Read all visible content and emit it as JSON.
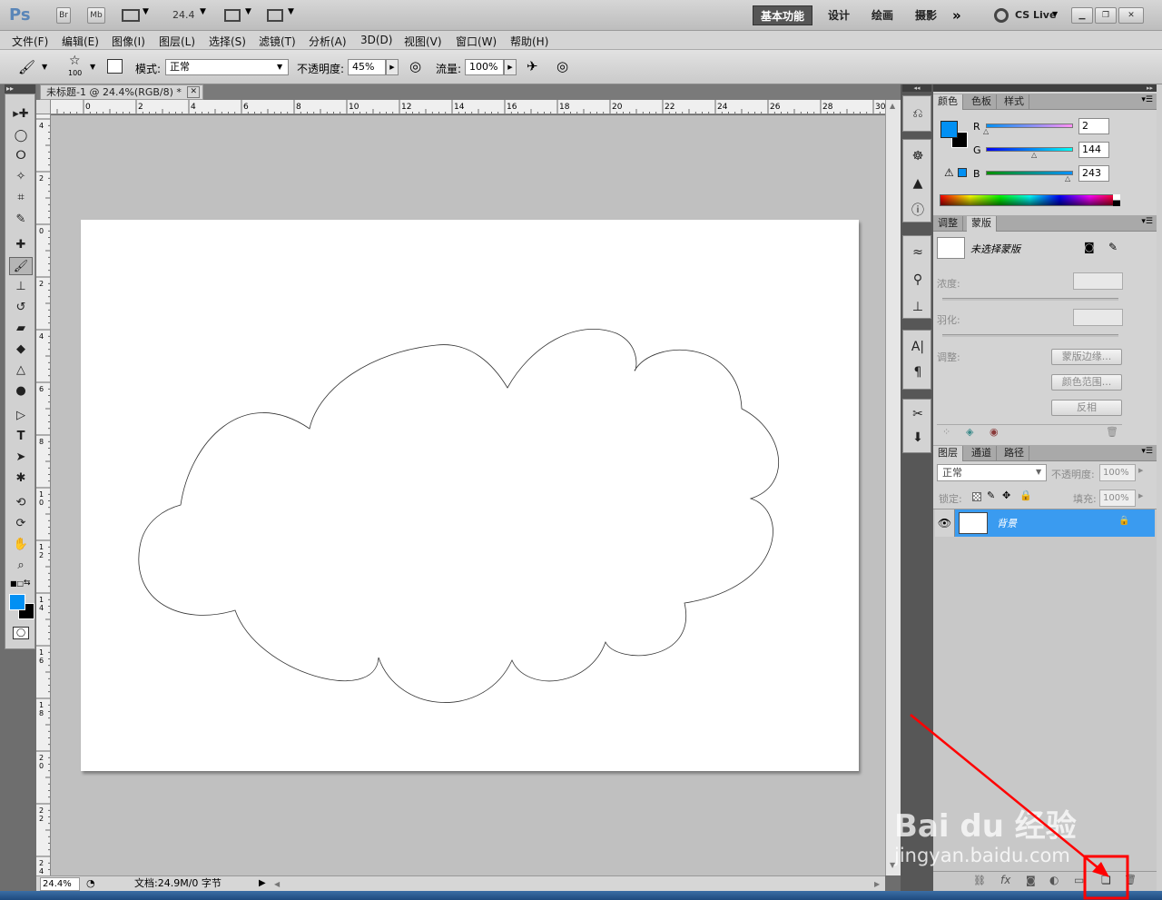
{
  "app": {
    "logo": "Ps",
    "br": "Br",
    "mb": "Mb",
    "zoom": "24.4"
  },
  "workspaces": [
    "基本功能",
    "设计",
    "绘画",
    "摄影"
  ],
  "cs_live": "CS Live",
  "menus": [
    "文件(F)",
    "编辑(E)",
    "图像(I)",
    "图层(L)",
    "选择(S)",
    "滤镜(T)",
    "分析(A)",
    "3D(D)",
    "视图(V)",
    "窗口(W)",
    "帮助(H)"
  ],
  "options": {
    "brush_size": "100",
    "mode_label": "模式:",
    "mode_value": "正常",
    "opacity_label": "不透明度:",
    "opacity_value": "45%",
    "flow_label": "流量:",
    "flow_value": "100%"
  },
  "document": {
    "tab_title": "未标题-1 @ 24.4%(RGB/8) *",
    "zoom_status": "24.4%",
    "doc_info": "文档:24.9M/0 字节"
  },
  "ruler": {
    "top": [
      "0",
      "2",
      "4",
      "6",
      "8",
      "10",
      "12",
      "14",
      "16",
      "18",
      "20",
      "22",
      "24",
      "26",
      "28",
      "30"
    ],
    "left": [
      "4",
      "2",
      "0",
      "2",
      "4",
      "6",
      "8",
      "1\n0",
      "1\n2",
      "1\n4",
      "1\n6",
      "1\n8",
      "2\n0",
      "2\n2",
      "2\n4"
    ]
  },
  "color_panel": {
    "tabs": [
      "颜色",
      "色板",
      "样式"
    ],
    "r_label": "R",
    "g_label": "G",
    "b_label": "B",
    "r": "2",
    "g": "144",
    "b": "243",
    "foreground": "#0290f3",
    "background": "#000000"
  },
  "masks_panel": {
    "tabs": [
      "调整",
      "蒙版"
    ],
    "mask_name": "未选择蒙版",
    "density": "浓度:",
    "feather": "羽化:",
    "refine": "调整:",
    "btn_edge": "蒙版边缘...",
    "btn_range": "颜色范围...",
    "btn_invert": "反相"
  },
  "layers_panel": {
    "tabs": [
      "图层",
      "通道",
      "路径"
    ],
    "blend": "正常",
    "opacity_label": "不透明度:",
    "opacity": "100%",
    "lock_label": "锁定:",
    "fill_label": "填充:",
    "fill": "100%",
    "layer_name": "背景"
  },
  "watermark": {
    "logo": "Bai du 经验",
    "url": "jingyan.baidu.com"
  },
  "colors": {
    "accent": "#3a9bf0",
    "annotation": "#ff0000"
  }
}
